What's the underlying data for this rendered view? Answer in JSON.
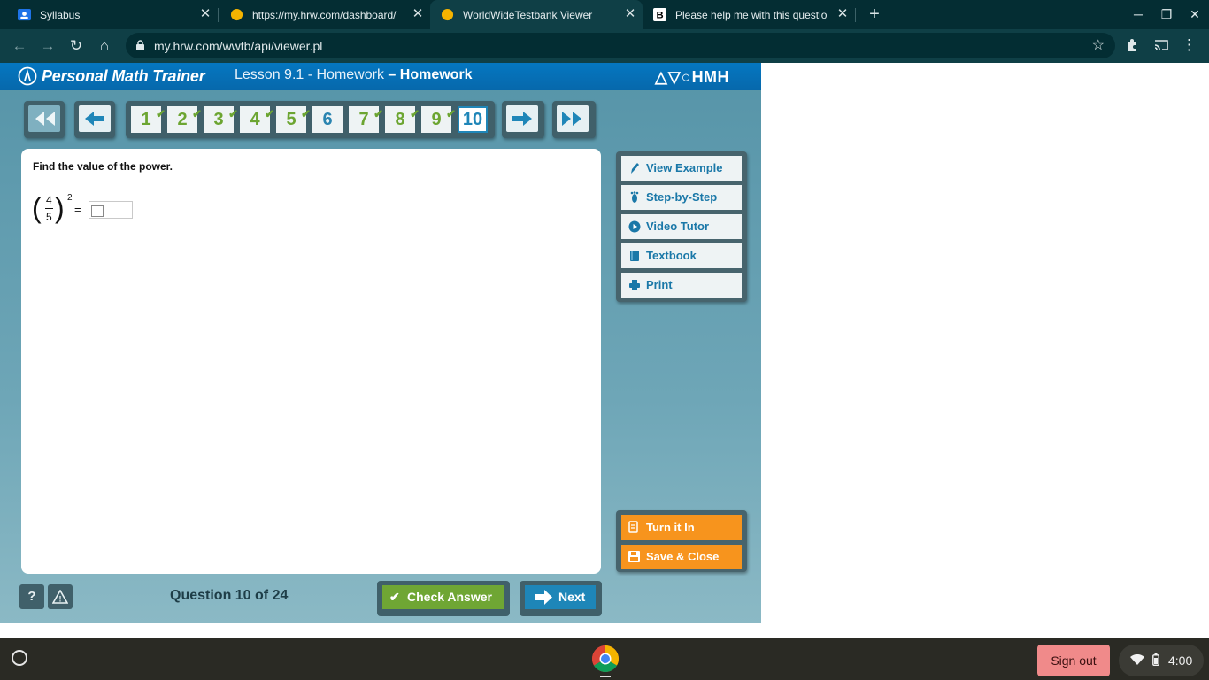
{
  "browser": {
    "tabs": [
      {
        "title": "Syllabus",
        "icon": "classroom-icon"
      },
      {
        "title": "https://my.hrw.com/dashboard/",
        "icon": "hmh-favicon"
      },
      {
        "title": "WorldWideTestbank Viewer",
        "icon": "hmh-favicon"
      },
      {
        "title": "Please help me with this questio",
        "icon": "brainly-favicon"
      }
    ],
    "url": "my.hrw.com/wwtb/api/viewer.pl"
  },
  "app": {
    "brand": "Personal Math Trainer",
    "lesson_prefix": "Lesson 9.1 - Homework",
    "lesson_suffix": "– Homework",
    "publisher": "HMH",
    "questions": [
      {
        "label": "1",
        "done": true
      },
      {
        "label": "2",
        "done": true
      },
      {
        "label": "3",
        "done": true
      },
      {
        "label": "4",
        "done": true
      },
      {
        "label": "5",
        "done": true
      },
      {
        "label": "6",
        "done": false
      },
      {
        "label": "7",
        "done": true
      },
      {
        "label": "8",
        "done": true
      },
      {
        "label": "9",
        "done": true
      },
      {
        "label": "10",
        "done": false,
        "current": true
      }
    ],
    "question": {
      "prompt": "Find the value of the power.",
      "numerator": "4",
      "denominator": "5",
      "exponent": "2",
      "equals": "=",
      "answer": ""
    },
    "side_buttons": [
      "View Example",
      "Step-by-Step",
      "Video Tutor",
      "Textbook",
      "Print"
    ],
    "turn_in": "Turn it In",
    "save_close": "Save & Close",
    "help": "?",
    "warning": "!",
    "question_count": "Question 10 of 24",
    "check_answer": "Check Answer",
    "next": "Next"
  },
  "shelf": {
    "sign_out": "Sign out",
    "time": "4:00"
  },
  "colors": {
    "header_blue": "#0577c1",
    "check_green": "#6fa634",
    "orange": "#f7941d",
    "next_blue": "#1e86b8"
  }
}
